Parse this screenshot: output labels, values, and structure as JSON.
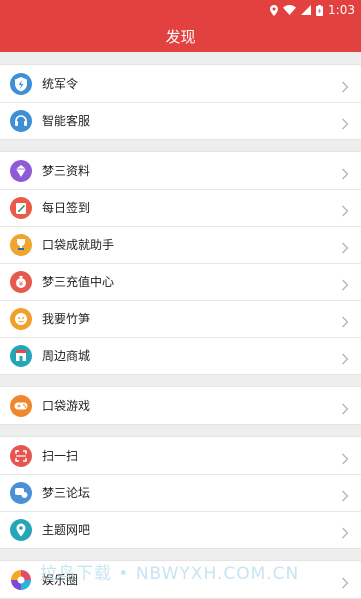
{
  "status": {
    "time": "1:03"
  },
  "header": {
    "title": "发现"
  },
  "groups": [
    {
      "items": [
        {
          "label": "统军令",
          "icon": "shield-lightning-icon",
          "color": "#3d8fd6"
        },
        {
          "label": "智能客服",
          "icon": "headset-icon",
          "color": "#3d8fd6"
        }
      ]
    },
    {
      "items": [
        {
          "label": "梦三资料",
          "icon": "gem-icon",
          "color": "#8e5ad8"
        },
        {
          "label": "每日签到",
          "icon": "pencil-note-icon",
          "color": "#ea5a4a"
        },
        {
          "label": "口袋成就助手",
          "icon": "trophy-icon",
          "color": "#f0a531"
        },
        {
          "label": "梦三充值中心",
          "icon": "money-bag-icon",
          "color": "#e55a4f"
        },
        {
          "label": "我要竹笋",
          "icon": "bamboo-icon",
          "color": "#f2a02a"
        },
        {
          "label": "周边商城",
          "icon": "shop-icon",
          "color": "#23a7b8"
        }
      ]
    },
    {
      "items": [
        {
          "label": "口袋游戏",
          "icon": "gamepad-icon",
          "color": "#f1872d"
        }
      ]
    },
    {
      "items": [
        {
          "label": "扫一扫",
          "icon": "scan-icon",
          "color": "#e75550"
        },
        {
          "label": "梦三论坛",
          "icon": "chat-icon",
          "color": "#4a8fd8"
        },
        {
          "label": "主题网吧",
          "icon": "location-pin-icon",
          "color": "#24a6b6"
        }
      ]
    },
    {
      "items": [
        {
          "label": "娱乐圈",
          "icon": "colorful-ring-icon",
          "color": "#d94a8b"
        }
      ]
    }
  ],
  "watermark": "拉鸟下载 • NBWYXH.COM.CN"
}
